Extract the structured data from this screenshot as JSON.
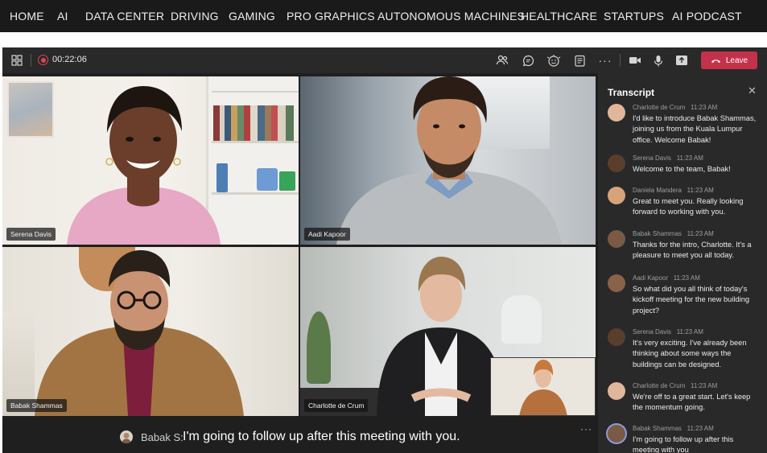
{
  "site_nav": {
    "items": [
      "HOME",
      "AI",
      "DATA CENTER",
      "DRIVING",
      "GAMING",
      "PRO GRAPHICS",
      "AUTONOMOUS MACHINES",
      "HEALTHCARE",
      "STARTUPS",
      "AI PODCAST"
    ]
  },
  "toolbar": {
    "timer": "00:22:06",
    "leave_label": "Leave",
    "more_label": "···"
  },
  "tiles": {
    "t1": "Serena Davis",
    "t2": "Aadi Kapoor",
    "t3": "Babak Shammas",
    "t4": "Charlotte de Crum"
  },
  "caption": {
    "speaker": "Babak S:",
    "text": "I'm going to follow up after this meeting with you.",
    "more": "···"
  },
  "transcript": {
    "title": "Transcript",
    "entries": [
      {
        "name": "Charlotte de Crum",
        "time": "11:23 AM",
        "text": "I'd like to introduce Babak Shammas, joining us from the Kuala Lumpur office. Welcome Babak!"
      },
      {
        "name": "Serena Davis",
        "time": "11:23 AM",
        "text": "Welcome to the team, Babak!"
      },
      {
        "name": "Daniela Mandera",
        "time": "11:23 AM",
        "text": "Great to meet you. Really looking forward to working with you."
      },
      {
        "name": "Babak Shammas",
        "time": "11:23 AM",
        "text": "Thanks for the intro, Charlotte. It's a pleasure to meet you all today."
      },
      {
        "name": "Aadi Kapoor",
        "time": "11:23 AM",
        "text": "So what did you all think of today's kickoff meeting for the new building project?"
      },
      {
        "name": "Serena Davis",
        "time": "11:23 AM",
        "text": "It's very exciting. I've already been thinking about some ways the buildings can be designed."
      },
      {
        "name": "Charlotte de Crum",
        "time": "11:23 AM",
        "text": "We're off to a great start. Let's keep the momentum going."
      },
      {
        "name": "Babak Shammas",
        "time": "11:23 AM",
        "text": "I'm going to follow up after this meeting with you"
      }
    ]
  },
  "colors": {
    "leave": "#c4314b",
    "record": "#e0424d",
    "panel": "#292929",
    "stage": "#1f1f1f"
  }
}
